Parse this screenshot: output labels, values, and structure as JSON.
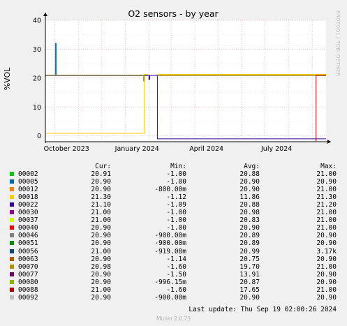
{
  "chart_data": {
    "type": "line",
    "title": "O2 sensors - by year",
    "ylabel": "%VOL",
    "ylim": [
      -2,
      40
    ],
    "yticks": [
      "40",
      "30",
      "20",
      "10",
      "0"
    ],
    "x_range": [
      "2023-09-19",
      "2024-09-19"
    ],
    "xticks": [
      "October 2023",
      "January 2024",
      "April 2024",
      "July 2024"
    ],
    "grid": true,
    "gap": [
      "2024-02-01",
      "2024-02-12"
    ],
    "series": [
      {
        "name": "00002",
        "color": "#00cc00",
        "points": [
          [
            "2023-09-19",
            20.9
          ],
          [
            "2024-01-31",
            20.9
          ],
          [
            "2024-02-12",
            20.9
          ],
          [
            "2024-09-19",
            20.9
          ]
        ]
      },
      {
        "name": "00005",
        "color": "#0066b3",
        "points": [
          [
            "2023-09-19",
            20.9
          ],
          [
            "2023-10-01",
            20.9
          ],
          [
            "2023-10-02",
            32.0
          ],
          [
            "2023-10-03",
            20.9
          ],
          [
            "2024-01-31",
            20.9
          ],
          [
            "2024-02-12",
            20.9
          ],
          [
            "2024-09-19",
            20.9
          ]
        ]
      },
      {
        "name": "00012",
        "color": "#ff8000",
        "points": [
          [
            "2024-02-12",
            20.9
          ],
          [
            "2024-09-19",
            20.9
          ]
        ]
      },
      {
        "name": "00018",
        "color": "#ffcc00",
        "points": [
          [
            "2023-09-19",
            0.9
          ],
          [
            "2024-01-25",
            0.9
          ],
          [
            "2024-01-26",
            21.3
          ],
          [
            "2024-01-31",
            21.3
          ],
          [
            "2024-02-12",
            21.3
          ],
          [
            "2024-09-19",
            21.3
          ]
        ]
      },
      {
        "name": "00022",
        "color": "#330099",
        "points": [
          [
            "2023-09-19",
            20.9
          ],
          [
            "2024-01-31",
            20.9
          ],
          [
            "2024-02-01",
            19.5
          ],
          [
            "2024-02-02",
            20.9
          ],
          [
            "2024-02-12",
            -1.0
          ],
          [
            "2024-09-19",
            -1.0
          ]
        ]
      },
      {
        "name": "00030",
        "color": "#990099",
        "points": [
          [
            "2024-02-12",
            21.0
          ],
          [
            "2024-09-19",
            21.0
          ]
        ]
      },
      {
        "name": "00037",
        "color": "#ccff00",
        "points": [
          [
            "2024-02-12",
            21.0
          ],
          [
            "2024-09-19",
            21.0
          ]
        ]
      },
      {
        "name": "00040",
        "color": "#ff0000",
        "points": [
          [
            "2023-09-19",
            20.9
          ],
          [
            "2024-09-19",
            20.9
          ]
        ]
      },
      {
        "name": "00046",
        "color": "#808080",
        "points": [
          [
            "2023-09-19",
            20.9
          ],
          [
            "2024-09-19",
            20.9
          ]
        ]
      },
      {
        "name": "00051",
        "color": "#008f00",
        "points": [
          [
            "2023-09-19",
            20.9
          ],
          [
            "2024-09-19",
            20.9
          ]
        ]
      },
      {
        "name": "00056",
        "color": "#00487d",
        "points": [
          [
            "2023-09-19",
            21.0
          ],
          [
            "2024-09-19",
            21.0
          ]
        ]
      },
      {
        "name": "00063",
        "color": "#b35a00",
        "points": [
          [
            "2023-09-19",
            20.7
          ],
          [
            "2024-09-19",
            20.9
          ]
        ]
      },
      {
        "name": "00070",
        "color": "#b38f00",
        "points": [
          [
            "2023-09-19",
            20.98
          ],
          [
            "2024-01-24",
            20.98
          ],
          [
            "2024-01-25",
            19.0
          ],
          [
            "2024-01-26",
            20.98
          ],
          [
            "2024-02-12",
            21.0
          ],
          [
            "2024-09-19",
            21.0
          ]
        ]
      },
      {
        "name": "00077",
        "color": "#6b006b",
        "points": [
          [
            "2023-09-19",
            20.9
          ],
          [
            "2024-09-19",
            20.9
          ]
        ]
      },
      {
        "name": "00080",
        "color": "#8fb300",
        "points": [
          [
            "2023-09-19",
            20.9
          ],
          [
            "2024-09-19",
            20.9
          ]
        ]
      },
      {
        "name": "00088",
        "color": "#b30000",
        "points": [
          [
            "2023-09-19",
            -1.6
          ],
          [
            "2024-09-05",
            -1.6
          ],
          [
            "2024-09-06",
            21.0
          ],
          [
            "2024-09-19",
            21.0
          ]
        ]
      },
      {
        "name": "00092",
        "color": "#bebebe",
        "points": [
          [
            "2023-09-19",
            20.9
          ],
          [
            "2024-09-19",
            20.9
          ]
        ]
      }
    ]
  },
  "legend": {
    "headers": {
      "cur": "Cur:",
      "min": "Min:",
      "avg": "Avg:",
      "max": "Max:"
    },
    "rows": [
      {
        "name": "00002",
        "color": "#00cc00",
        "cur": "20.91",
        "min": "-1.00",
        "avg": "20.88",
        "max": "21.00"
      },
      {
        "name": "00005",
        "color": "#0066b3",
        "cur": "20.90",
        "min": "-1.00",
        "avg": "20.90",
        "max": "20.90"
      },
      {
        "name": "00012",
        "color": "#ff8000",
        "cur": "20.90",
        "min": "-800.00m",
        "avg": "20.90",
        "max": "21.00"
      },
      {
        "name": "00018",
        "color": "#ffcc00",
        "cur": "21.30",
        "min": "-1.12",
        "avg": "11.86",
        "max": "21.30"
      },
      {
        "name": "00022",
        "color": "#330099",
        "cur": "21.10",
        "min": "-1.09",
        "avg": "20.88",
        "max": "21.20"
      },
      {
        "name": "00030",
        "color": "#990099",
        "cur": "21.00",
        "min": "-1.00",
        "avg": "20.98",
        "max": "21.00"
      },
      {
        "name": "00037",
        "color": "#ccff00",
        "cur": "21.00",
        "min": "-1.00",
        "avg": "20.83",
        "max": "21.00"
      },
      {
        "name": "00040",
        "color": "#ff0000",
        "cur": "20.90",
        "min": "-1.00",
        "avg": "20.90",
        "max": "21.00"
      },
      {
        "name": "00046",
        "color": "#808080",
        "cur": "20.90",
        "min": "-900.00m",
        "avg": "20.89",
        "max": "20.90"
      },
      {
        "name": "00051",
        "color": "#008f00",
        "cur": "20.90",
        "min": "-900.00m",
        "avg": "20.89",
        "max": "20.90"
      },
      {
        "name": "00056",
        "color": "#00487d",
        "cur": "21.00",
        "min": "-919.08m",
        "avg": "20.99",
        "max": "3.17k"
      },
      {
        "name": "00063",
        "color": "#b35a00",
        "cur": "20.90",
        "min": "-1.14",
        "avg": "20.75",
        "max": "20.90"
      },
      {
        "name": "00070",
        "color": "#b38f00",
        "cur": "20.98",
        "min": "-1.60",
        "avg": "19.70",
        "max": "21.00"
      },
      {
        "name": "00077",
        "color": "#6b006b",
        "cur": "20.90",
        "min": "-1.50",
        "avg": "13.91",
        "max": "20.90"
      },
      {
        "name": "00080",
        "color": "#8fb300",
        "cur": "20.90",
        "min": "-996.15m",
        "avg": "20.87",
        "max": "20.90"
      },
      {
        "name": "00088",
        "color": "#b30000",
        "cur": "21.00",
        "min": "-1.60",
        "avg": "17.65",
        "max": "21.00"
      },
      {
        "name": "00092",
        "color": "#bebebe",
        "cur": "20.90",
        "min": "-900.00m",
        "avg": "20.90",
        "max": "20.90"
      }
    ]
  },
  "last_update": "Last update: Thu Sep 19 02:00:26 2024",
  "footer": "Munin 2.0.73",
  "watermark": "RRDTOOL / TOBI OETIKER"
}
